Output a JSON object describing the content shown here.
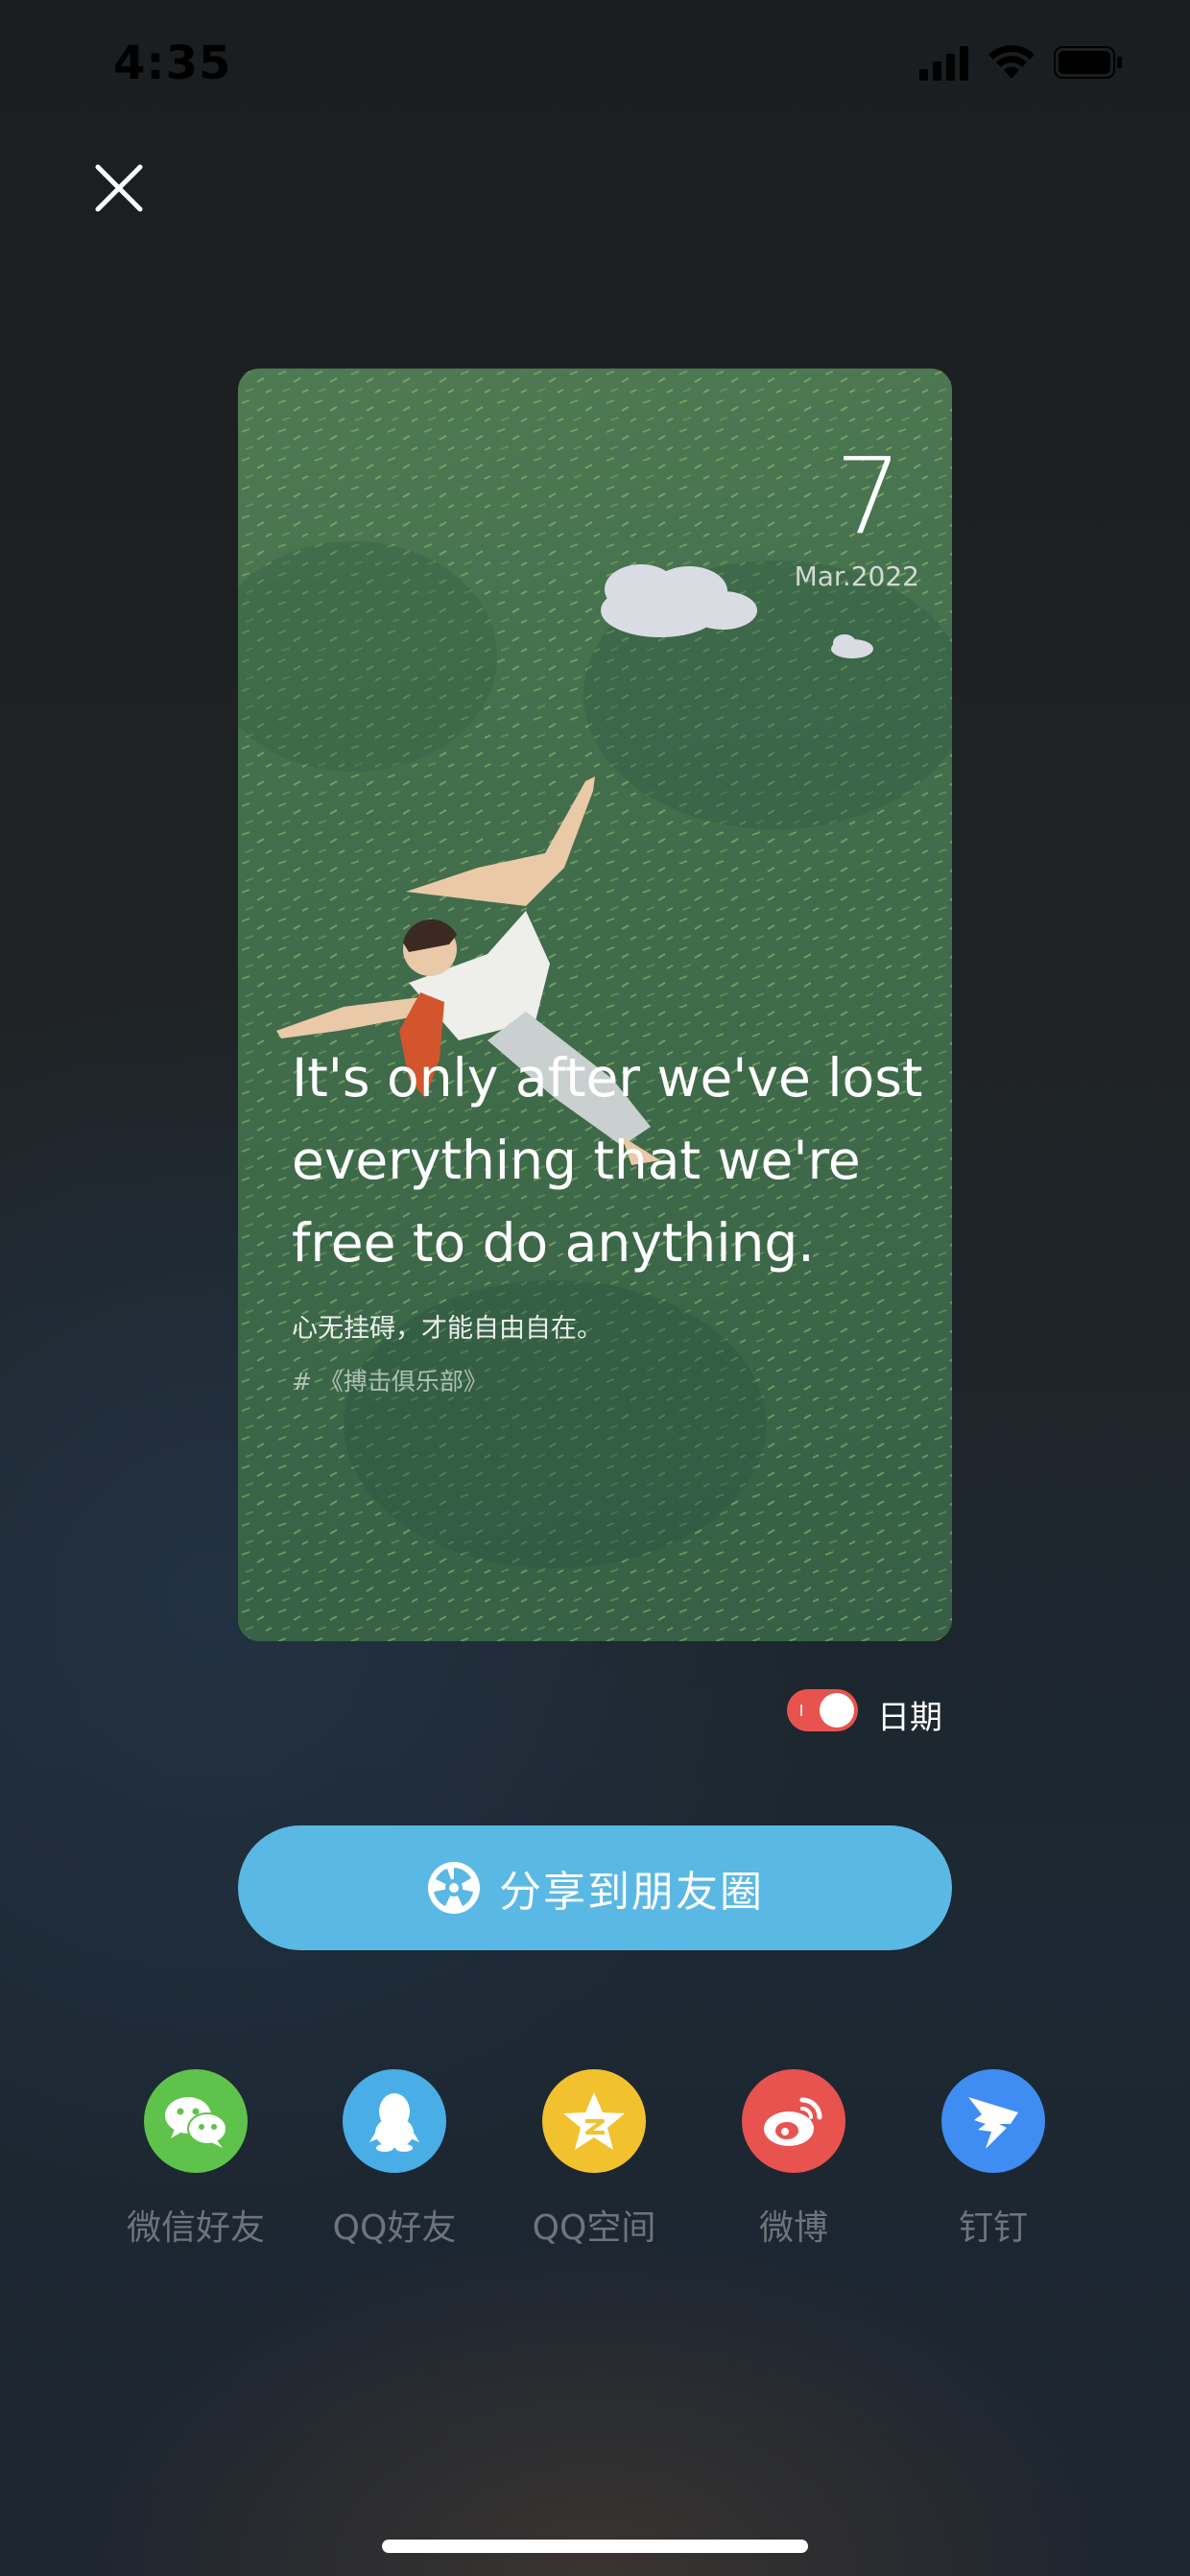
{
  "status_bar": {
    "time": "4:35"
  },
  "card": {
    "date_day": "7",
    "date_month": "Mar.2022",
    "quote_en": "It's only after we've lost everything that we're free to do anything.",
    "quote_cn": "心无挂碍，才能自由自在。",
    "quote_source": "# 《搏击俱乐部》"
  },
  "toggle": {
    "label": "日期",
    "on": true,
    "color": "#e8534f"
  },
  "share_button": {
    "label": "分享到朋友圈",
    "color": "#5ab8e4"
  },
  "share_targets": [
    {
      "label": "微信好友",
      "icon": "wechat-icon",
      "color": "#5fc24a"
    },
    {
      "label": "QQ好友",
      "icon": "qq-icon",
      "color": "#4aaee6"
    },
    {
      "label": "QQ空间",
      "icon": "qzone-icon",
      "color": "#f2c12e"
    },
    {
      "label": "微博",
      "icon": "weibo-icon",
      "color": "#e8524f"
    },
    {
      "label": "钉钉",
      "icon": "dingtalk-icon",
      "color": "#3f8cf2"
    }
  ]
}
